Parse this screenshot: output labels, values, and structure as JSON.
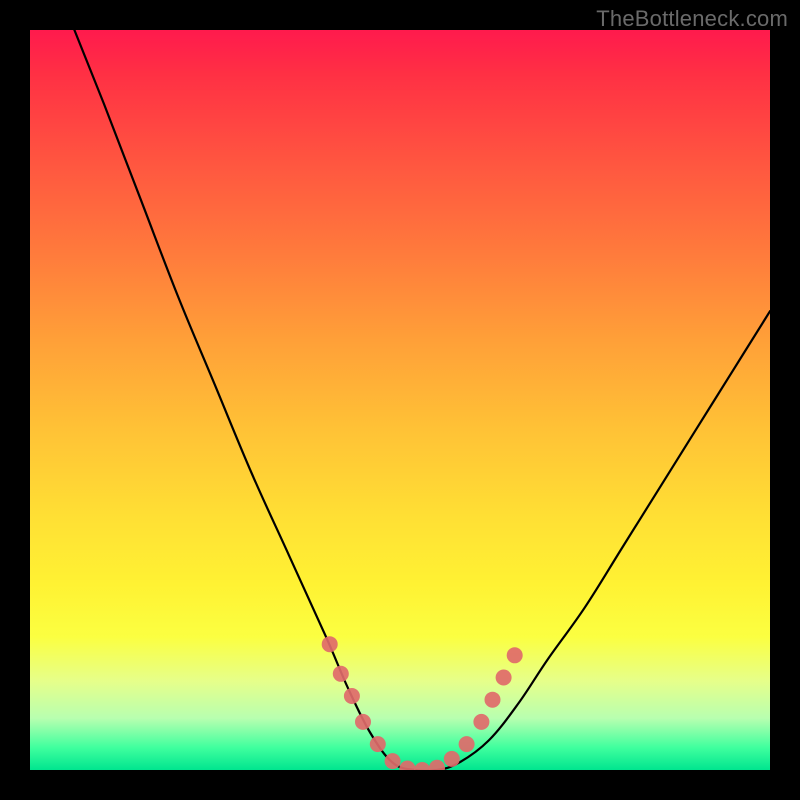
{
  "watermark": "TheBottleneck.com",
  "chart_data": {
    "type": "line",
    "title": "",
    "xlabel": "",
    "ylabel": "",
    "xlim": [
      0,
      100
    ],
    "ylim": [
      0,
      100
    ],
    "series": [
      {
        "name": "bottleneck-curve",
        "x": [
          6,
          10,
          15,
          20,
          25,
          30,
          35,
          40,
          43,
          46,
          49,
          52,
          55,
          58,
          62,
          66,
          70,
          75,
          80,
          85,
          90,
          95,
          100
        ],
        "values": [
          100,
          90,
          77,
          64,
          52,
          40,
          29,
          18,
          11,
          5,
          1,
          0,
          0,
          1,
          4,
          9,
          15,
          22,
          30,
          38,
          46,
          54,
          62
        ]
      }
    ],
    "markers": {
      "name": "dotted-region",
      "x": [
        40.5,
        42,
        43.5,
        45,
        47,
        49,
        51,
        53,
        55,
        57,
        59,
        61,
        62.5,
        64,
        65.5
      ],
      "values": [
        17,
        13,
        10,
        6.5,
        3.5,
        1.2,
        0.2,
        0,
        0.3,
        1.5,
        3.5,
        6.5,
        9.5,
        12.5,
        15.5
      ]
    }
  }
}
